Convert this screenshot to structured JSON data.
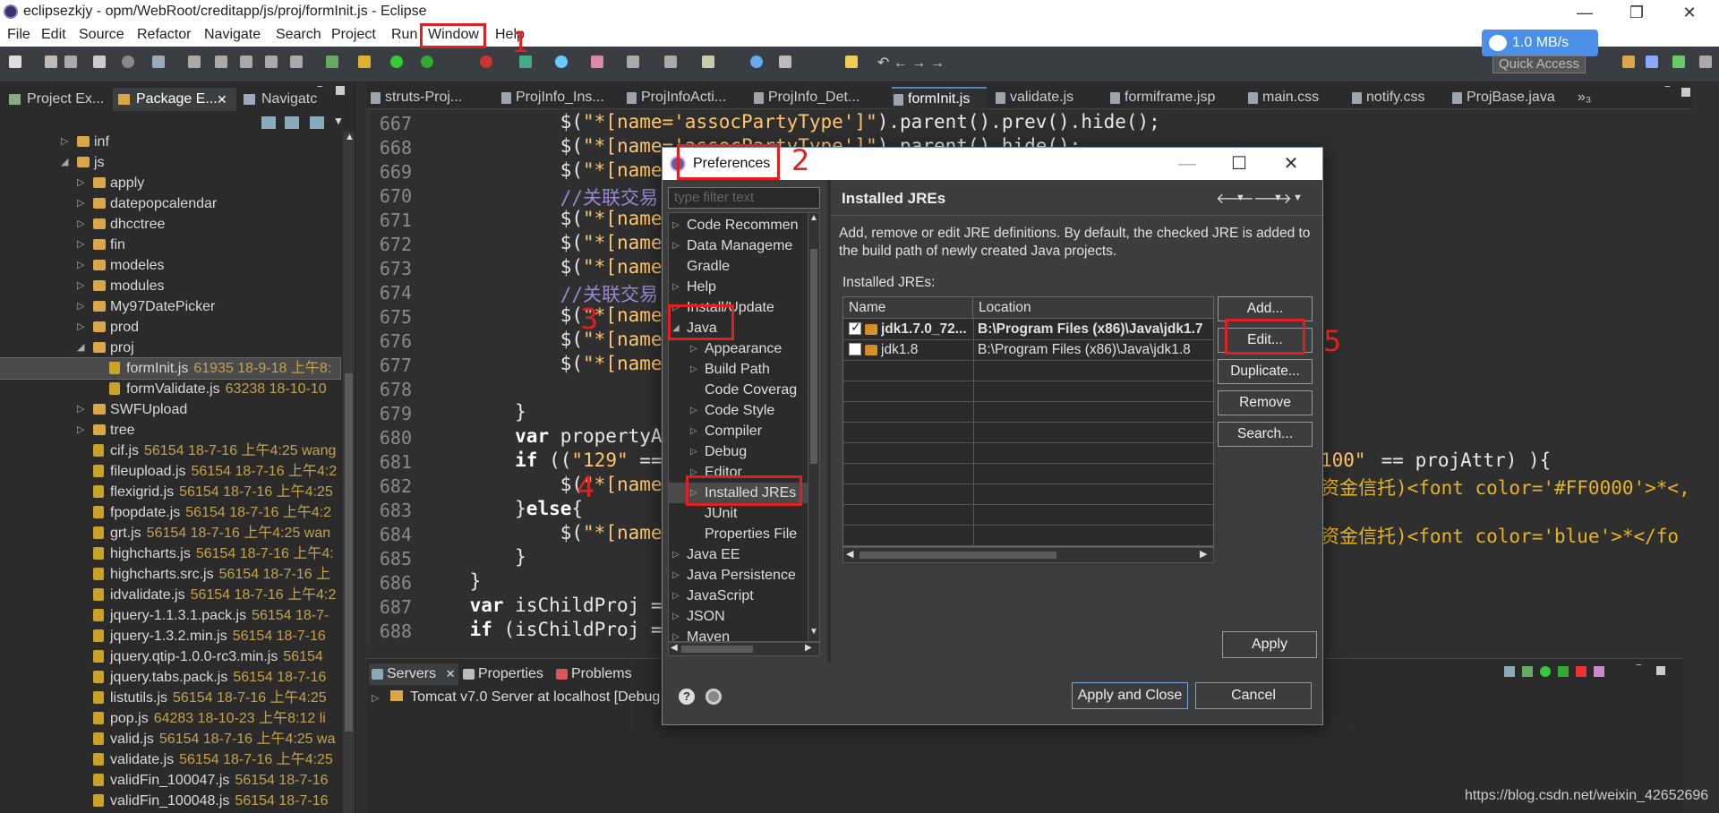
{
  "window": {
    "title": "eclipsezkjy - opm/WebRoot/creditapp/js/proj/formInit.js - Eclipse",
    "controls": [
      "—",
      "❐",
      "✕"
    ]
  },
  "menubar": [
    "File",
    "Edit",
    "Source",
    "Refactor",
    "Navigate",
    "Search",
    "Project",
    "Run",
    "Window",
    "Help"
  ],
  "net_speed": "1.0 MB/s",
  "quick_access": "Quick Access",
  "left_panel": {
    "tabs": [
      "Project Ex...",
      "Package E...",
      "Navigatc"
    ],
    "tree": [
      {
        "label": "inf",
        "indent": 1,
        "folder": true,
        "arrow": "▷"
      },
      {
        "label": "js",
        "indent": 1,
        "folder": true,
        "arrow": "◢"
      },
      {
        "label": "apply",
        "indent": 2,
        "folder": true,
        "arrow": "▷"
      },
      {
        "label": "datepopcalendar",
        "indent": 2,
        "folder": true,
        "arrow": "▷"
      },
      {
        "label": "dhcctree",
        "indent": 2,
        "folder": true,
        "arrow": "▷"
      },
      {
        "label": "fin",
        "indent": 2,
        "folder": true,
        "arrow": "▷"
      },
      {
        "label": "modeles",
        "indent": 2,
        "folder": true,
        "arrow": "▷"
      },
      {
        "label": "modules",
        "indent": 2,
        "folder": true,
        "arrow": "▷"
      },
      {
        "label": "My97DatePicker",
        "indent": 2,
        "folder": true,
        "arrow": "▷"
      },
      {
        "label": "prod",
        "indent": 2,
        "folder": true,
        "arrow": "▷"
      },
      {
        "label": "proj",
        "indent": 2,
        "folder": true,
        "arrow": "◢"
      },
      {
        "label": "formInit.js",
        "meta": "61935  18-9-18 上午8:",
        "indent": 3,
        "folder": false,
        "selected": true
      },
      {
        "label": "formValidate.js",
        "meta": "63238  18-10-10",
        "indent": 3,
        "folder": false
      },
      {
        "label": "SWFUpload",
        "indent": 2,
        "folder": true,
        "arrow": "▷"
      },
      {
        "label": "tree",
        "indent": 2,
        "folder": true,
        "arrow": "▷"
      },
      {
        "label": "cif.js",
        "meta": "56154  18-7-16 上午4:25  wang",
        "indent": 2,
        "folder": false
      },
      {
        "label": "fileupload.js",
        "meta": "56154  18-7-16 上午4:2",
        "indent": 2,
        "folder": false
      },
      {
        "label": "flexigrid.js",
        "meta": "56154  18-7-16 上午4:25",
        "indent": 2,
        "folder": false
      },
      {
        "label": "fpopdate.js",
        "meta": "56154  18-7-16 上午4:2",
        "indent": 2,
        "folder": false
      },
      {
        "label": "grt.js",
        "meta": "56154  18-7-16 上午4:25  wan",
        "indent": 2,
        "folder": false
      },
      {
        "label": "highcharts.js",
        "meta": "56154  18-7-16 上午4:",
        "indent": 2,
        "folder": false
      },
      {
        "label": "highcharts.src.js",
        "meta": "56154  18-7-16 上",
        "indent": 2,
        "folder": false
      },
      {
        "label": "idvalidate.js",
        "meta": "56154  18-7-16 上午4:2",
        "indent": 2,
        "folder": false
      },
      {
        "label": "jquery-1.1.3.1.pack.js",
        "meta": "56154  18-7-",
        "indent": 2,
        "folder": false
      },
      {
        "label": "jquery-1.3.2.min.js",
        "meta": "56154  18-7-16",
        "indent": 2,
        "folder": false
      },
      {
        "label": "jquery.qtip-1.0.0-rc3.min.js",
        "meta": "56154",
        "indent": 2,
        "folder": false
      },
      {
        "label": "jquery.tabs.pack.js",
        "meta": "56154  18-7-16",
        "indent": 2,
        "folder": false
      },
      {
        "label": "listutils.js",
        "meta": "56154  18-7-16 上午4:25",
        "indent": 2,
        "folder": false
      },
      {
        "label": "pop.js",
        "meta": "64283  18-10-23 上午8:12  li",
        "indent": 2,
        "folder": false
      },
      {
        "label": "valid.js",
        "meta": "56154  18-7-16 上午4:25  wa",
        "indent": 2,
        "folder": false
      },
      {
        "label": "validate.js",
        "meta": "56154  18-7-16 上午4:25",
        "indent": 2,
        "folder": false
      },
      {
        "label": "validFin_100047.js",
        "meta": "56154  18-7-16",
        "indent": 2,
        "folder": false
      },
      {
        "label": "validFin_100048.js",
        "meta": "56154  18-7-16",
        "indent": 2,
        "folder": false
      }
    ]
  },
  "editor_tabs": [
    "struts-Proj...",
    "ProjInfo_Ins...",
    "ProjInfoActi...",
    "ProjInfo_Det...",
    "formInit.js",
    "validate.js",
    "formiframe.jsp",
    "main.css",
    "notify.css",
    "ProjBase.java",
    "»₃"
  ],
  "code_lines": [
    {
      "n": "667",
      "segs": [
        [
          "            $(",
          ""
        ],
        [
          "\"*[name='assocPartyType']\"",
          "str"
        ],
        [
          ").parent().prev().hide();",
          ""
        ]
      ]
    },
    {
      "n": "668",
      "segs": [
        [
          "            $(",
          ""
        ],
        [
          "\"*[name='assocPartyType']\"",
          "str"
        ],
        [
          ").parent().hide();",
          ""
        ]
      ]
    },
    {
      "n": "669",
      "segs": [
        [
          "            $(",
          ""
        ],
        [
          "\"*[name",
          "str"
        ]
      ]
    },
    {
      "n": "670",
      "segs": [
        [
          "            //关联交易",
          "cmt"
        ]
      ]
    },
    {
      "n": "671",
      "segs": [
        [
          "            $(",
          ""
        ],
        [
          "\"*[name",
          "str"
        ]
      ]
    },
    {
      "n": "672",
      "segs": [
        [
          "            $(",
          ""
        ],
        [
          "\"*[name",
          "str"
        ]
      ]
    },
    {
      "n": "673",
      "segs": [
        [
          "            $(",
          ""
        ],
        [
          "\"*[name",
          "str"
        ]
      ]
    },
    {
      "n": "674",
      "segs": [
        [
          "            //关联交易",
          "cmt"
        ]
      ]
    },
    {
      "n": "675",
      "segs": [
        [
          "            $(",
          ""
        ],
        [
          "\"*[name",
          "str"
        ]
      ]
    },
    {
      "n": "676",
      "segs": [
        [
          "            $(",
          ""
        ],
        [
          "\"*[name",
          "str"
        ]
      ]
    },
    {
      "n": "677",
      "segs": [
        [
          "            $(",
          ""
        ],
        [
          "\"*[name",
          "str"
        ]
      ]
    },
    {
      "n": "678",
      "segs": [
        [
          "",
          ""
        ]
      ]
    },
    {
      "n": "679",
      "segs": [
        [
          "        }",
          ""
        ]
      ]
    },
    {
      "n": "680",
      "segs": [
        [
          "        ",
          ""
        ],
        [
          "var",
          "kw"
        ],
        [
          " propertyA",
          ""
        ]
      ]
    },
    {
      "n": "681",
      "segs": [
        [
          "        ",
          ""
        ],
        [
          "if",
          "kw"
        ],
        [
          " ((",
          ""
        ],
        [
          "\"129\"",
          "str"
        ],
        [
          " ==",
          ""
        ]
      ]
    },
    {
      "n": "682",
      "segs": [
        [
          "            $(",
          ""
        ],
        [
          "\"*[name",
          "str"
        ]
      ]
    },
    {
      "n": "683",
      "segs": [
        [
          "        }",
          ""
        ],
        [
          "else",
          "kw"
        ],
        [
          "{",
          ""
        ]
      ]
    },
    {
      "n": "684",
      "segs": [
        [
          "            $(",
          ""
        ],
        [
          "\"*[name",
          "str"
        ]
      ]
    },
    {
      "n": "685",
      "segs": [
        [
          "        }",
          ""
        ]
      ]
    },
    {
      "n": "686",
      "segs": [
        [
          "    }",
          ""
        ]
      ]
    },
    {
      "n": "687",
      "segs": [
        [
          "    ",
          ""
        ],
        [
          "var",
          "kw"
        ],
        [
          " isChildProj =",
          ""
        ]
      ]
    },
    {
      "n": "688",
      "segs": [
        [
          "    ",
          ""
        ],
        [
          "if",
          "kw"
        ],
        [
          " (isChildProj =",
          ""
        ]
      ]
    }
  ],
  "code_right_fragments": {
    "r681": [
      "100\"",
      " == projAttr) ){"
    ],
    "r682": [
      "资金信托)<font color='#FF0000'>*<,"
    ],
    "r684": [
      "资金信托)<font color='blue'>*</fo"
    ]
  },
  "bottom_tabs": [
    "Servers",
    "Properties",
    "Problems"
  ],
  "server_row": "Tomcat v7.0 Server at localhost  [Debug",
  "watermark": "https://blog.csdn.net/weixin_42652696",
  "dialog": {
    "title": "Preferences",
    "filter_placeholder": "type filter text",
    "nav": [
      {
        "label": "Code Recommen",
        "arrow": "▷",
        "indent": 0
      },
      {
        "label": "Data Manageme",
        "arrow": "▷",
        "indent": 0
      },
      {
        "label": "Gradle",
        "arrow": "",
        "indent": 0
      },
      {
        "label": "Help",
        "arrow": "▷",
        "indent": 0
      },
      {
        "label": "Install/Update",
        "arrow": "▷",
        "indent": 0
      },
      {
        "label": "Java",
        "arrow": "◢",
        "indent": 0
      },
      {
        "label": "Appearance",
        "arrow": "▷",
        "indent": 1
      },
      {
        "label": "Build Path",
        "arrow": "▷",
        "indent": 1
      },
      {
        "label": "Code Coverag",
        "arrow": "",
        "indent": 1
      },
      {
        "label": "Code Style",
        "arrow": "▷",
        "indent": 1
      },
      {
        "label": "Compiler",
        "arrow": "▷",
        "indent": 1
      },
      {
        "label": "Debug",
        "arrow": "▷",
        "indent": 1
      },
      {
        "label": "Editor",
        "arrow": "▷",
        "indent": 1
      },
      {
        "label": "Installed JREs",
        "arrow": "▷",
        "indent": 1,
        "selected": true
      },
      {
        "label": "JUnit",
        "arrow": "",
        "indent": 1
      },
      {
        "label": "Properties File",
        "arrow": "",
        "indent": 1
      },
      {
        "label": "Java EE",
        "arrow": "▷",
        "indent": 0
      },
      {
        "label": "Java Persistence",
        "arrow": "▷",
        "indent": 0
      },
      {
        "label": "JavaScript",
        "arrow": "▷",
        "indent": 0
      },
      {
        "label": "JSON",
        "arrow": "▷",
        "indent": 0
      },
      {
        "label": "Maven",
        "arrow": "▷",
        "indent": 0
      }
    ],
    "page_title": "Installed JREs",
    "description": "Add, remove or edit JRE definitions. By default, the checked JRE is added to the build path of newly created Java projects.",
    "installed_label": "Installed JREs:",
    "columns": [
      "Name",
      "Location"
    ],
    "jres": [
      {
        "name": "jdk1.7.0_72...",
        "location": "B:\\Program Files (x86)\\Java\\jdk1.7",
        "checked": true,
        "bold": true
      },
      {
        "name": "jdk1.8",
        "location": "B:\\Program Files (x86)\\Java\\jdk1.8",
        "checked": false,
        "bold": false
      }
    ],
    "side_buttons": [
      "Add...",
      "Edit...",
      "Duplicate...",
      "Remove",
      "Search..."
    ],
    "apply": "Apply",
    "apply_close": "Apply and Close",
    "cancel": "Cancel"
  },
  "annotations": [
    "1",
    "2",
    "3",
    "4",
    "5"
  ],
  "colors": {
    "annotation": "#e02020",
    "accent": "#4a88c7"
  }
}
